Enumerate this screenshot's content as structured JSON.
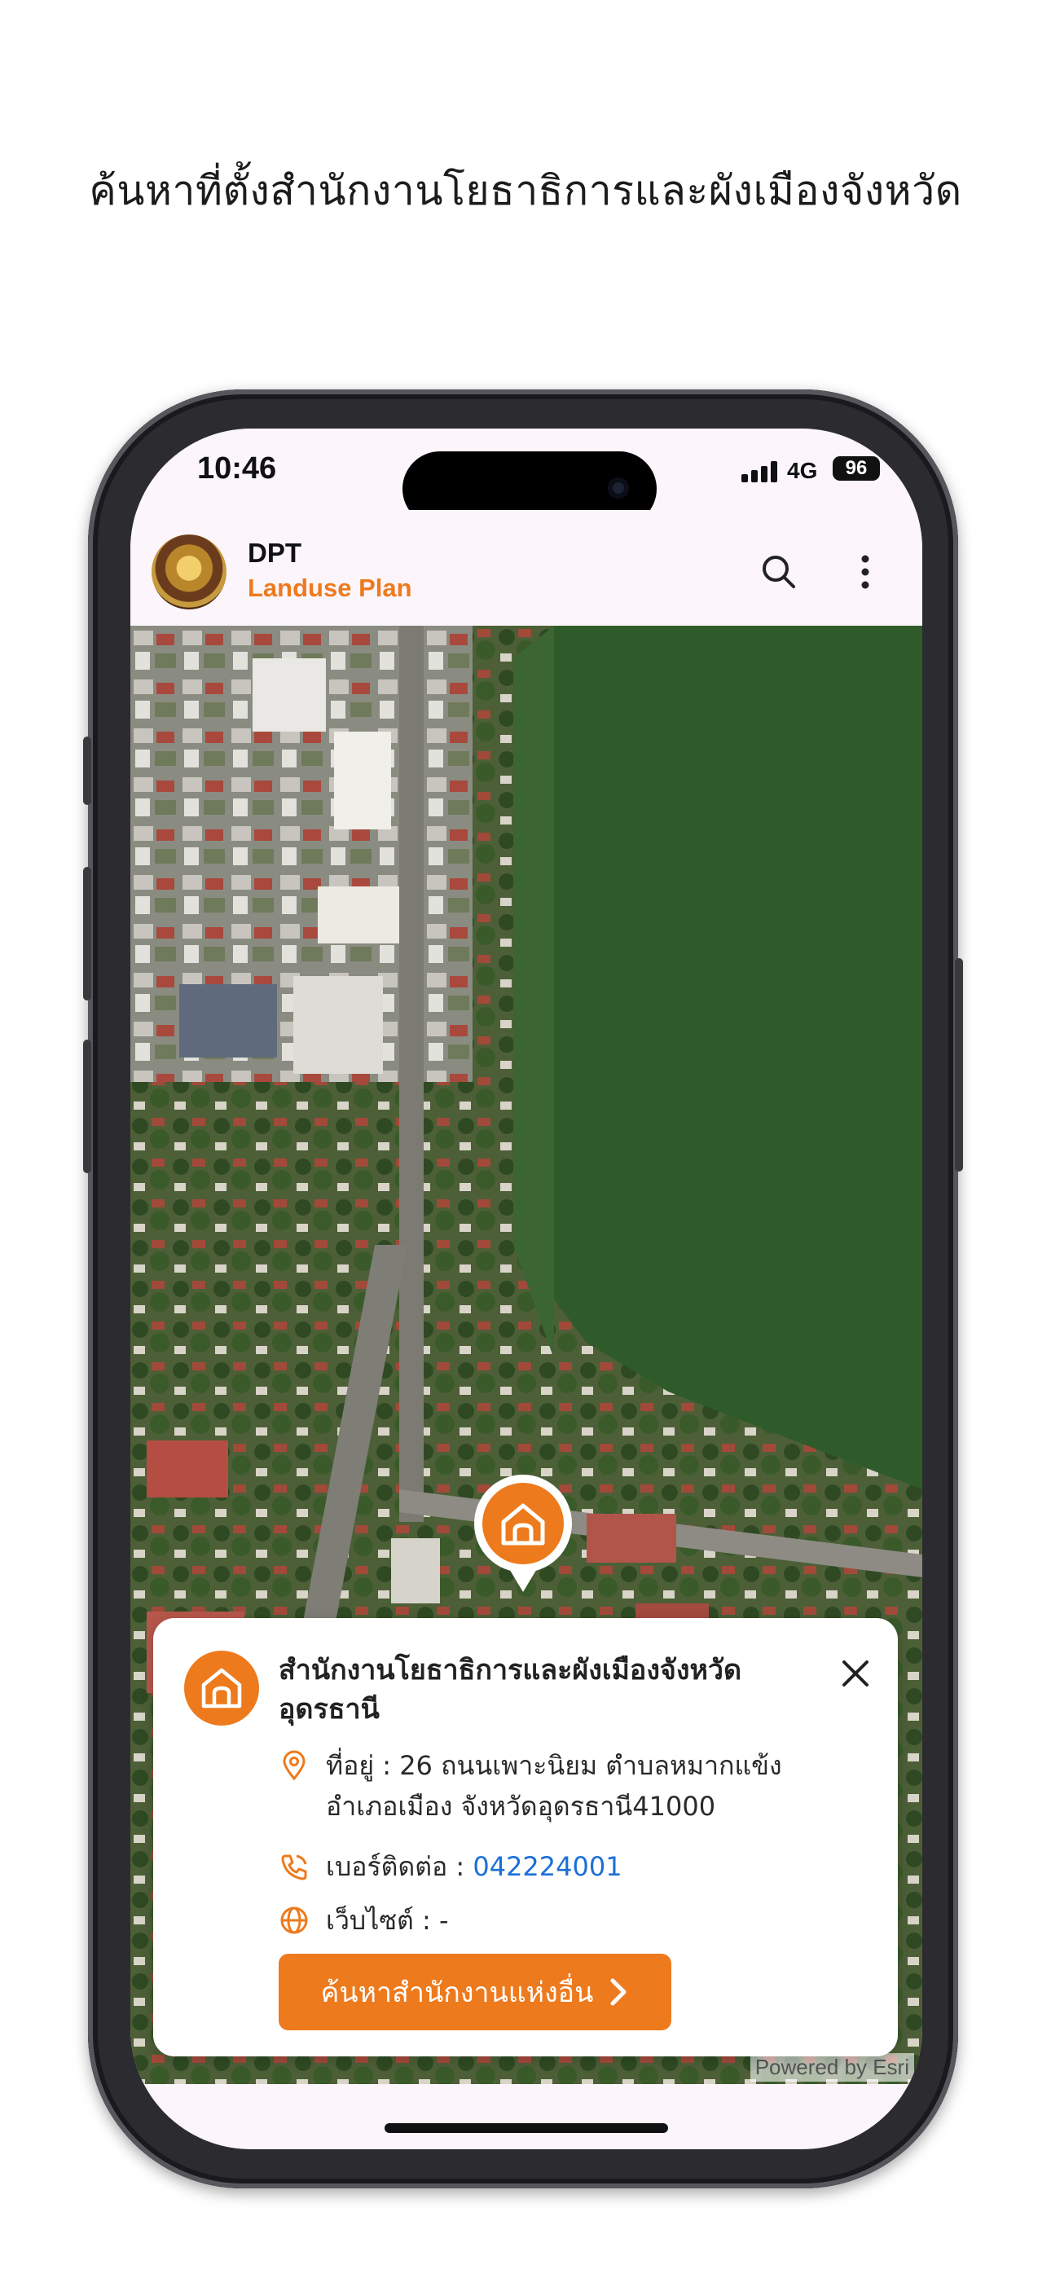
{
  "headline": "ค้นหาที่ตั้งสำนักงานโยธาธิการและผังเมืองจังหวัด",
  "status_bar": {
    "time": "10:46",
    "network": "4G",
    "battery": "96"
  },
  "app_bar": {
    "title": "DPT",
    "subtitle": "Landuse Plan",
    "search_icon": "search-icon",
    "menu_icon": "more-vertical-icon"
  },
  "map": {
    "attribution": "Powered by Esri",
    "marker_icon": "home-icon"
  },
  "info_card": {
    "title": "สำนักงานโยธาธิการและผังเมืองจังหวัดอุดรธานี",
    "address_label": "ที่อยู่ : 26 ถนนเพาะนิยม ตำบลหมากแข้ง อำเภอเมือง จังหวัดอุดรธานี41000",
    "phone_label": "เบอร์ติดต่อ : ",
    "phone_value": "042224001",
    "website_label": "เว็บไซต์ : -",
    "cta_label": "ค้นหาสำนักงานแห่งอื่น",
    "icons": [
      "home-icon",
      "close-icon",
      "location-pin-icon",
      "phone-icon",
      "globe-icon",
      "chevron-right-icon"
    ]
  },
  "colors": {
    "accent": "#ee7a1e",
    "link": "#1c6fd6",
    "water": "#2f5a2a"
  }
}
